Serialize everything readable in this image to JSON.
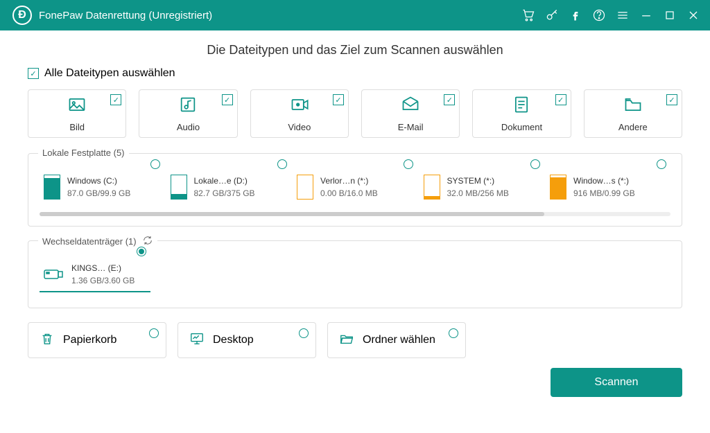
{
  "app": {
    "title": "FonePaw Datenrettung (Unregistriert)"
  },
  "heading": "Die Dateitypen und das Ziel zum Scannen auswählen",
  "selectAll": "Alle Dateitypen auswählen",
  "types": [
    {
      "label": "Bild"
    },
    {
      "label": "Audio"
    },
    {
      "label": "Video"
    },
    {
      "label": "E-Mail"
    },
    {
      "label": "Dokument"
    },
    {
      "label": "Andere"
    }
  ],
  "localLegend": "Lokale Festplatte (5)",
  "drives": [
    {
      "name": "Windows (C:)",
      "size": "87.0 GB/99.9 GB",
      "color": "#0d9488",
      "pct": 87
    },
    {
      "name": "Lokale…e (D:)",
      "size": "82.7 GB/375 GB",
      "color": "#0d9488",
      "pct": 22
    },
    {
      "name": "Verlor…n (*:)",
      "size": "0.00  B/16.0 MB",
      "color": "#f59e0b",
      "pct": 0
    },
    {
      "name": "SYSTEM (*:)",
      "size": "32.0 MB/256 MB",
      "color": "#f59e0b",
      "pct": 13
    },
    {
      "name": "Window…s (*:)",
      "size": "916 MB/0.99 GB",
      "color": "#f59e0b",
      "pct": 92
    }
  ],
  "removableLegend": "Wechseldatenträger (1)",
  "removable": [
    {
      "name": "KINGS… (E:)",
      "size": "1.36 GB/3.60 GB"
    }
  ],
  "places": [
    {
      "label": "Papierkorb"
    },
    {
      "label": "Desktop"
    },
    {
      "label": "Ordner wählen"
    }
  ],
  "scan": "Scannen"
}
